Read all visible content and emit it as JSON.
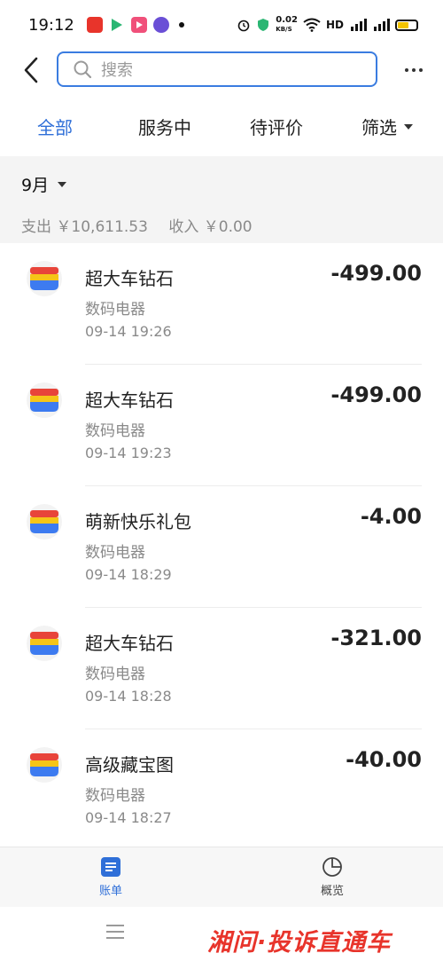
{
  "status_bar": {
    "time": "19:12",
    "net_speed_top": "0.02",
    "net_speed_unit": "KB/S",
    "hd_label": "HD",
    "battery_color": "#f2c400"
  },
  "header": {
    "back_icon": "chevron-left-icon",
    "search_placeholder": "搜索",
    "more_icon": "more-horizontal-icon"
  },
  "tabs": [
    {
      "label": "全部",
      "active": true
    },
    {
      "label": "服务中",
      "active": false
    },
    {
      "label": "待评价",
      "active": false
    },
    {
      "label": "筛选",
      "active": false
    }
  ],
  "summary": {
    "month": "9月",
    "expense": "支出 ￥10,611.53",
    "income": "收入 ￥0.00"
  },
  "transactions": [
    {
      "title": "超大车钻石",
      "category": "数码电器",
      "time": "09-14  19:26",
      "amount": "-499.00"
    },
    {
      "title": "超大车钻石",
      "category": "数码电器",
      "time": "09-14  19:23",
      "amount": "-499.00"
    },
    {
      "title": "萌新快乐礼包",
      "category": "数码电器",
      "time": "09-14  18:29",
      "amount": "-4.00"
    },
    {
      "title": "超大车钻石",
      "category": "数码电器",
      "time": "09-14  18:28",
      "amount": "-321.00"
    },
    {
      "title": "高级藏宝图",
      "category": "数码电器",
      "time": "09-14  18:27",
      "amount": "-40.00"
    }
  ],
  "bottom_tabs": {
    "bill": "账单",
    "overview": "概览"
  },
  "watermark": "湘问·投诉直通车",
  "colors": {
    "accent": "#2f6fd8",
    "watermark": "#e8342b"
  }
}
